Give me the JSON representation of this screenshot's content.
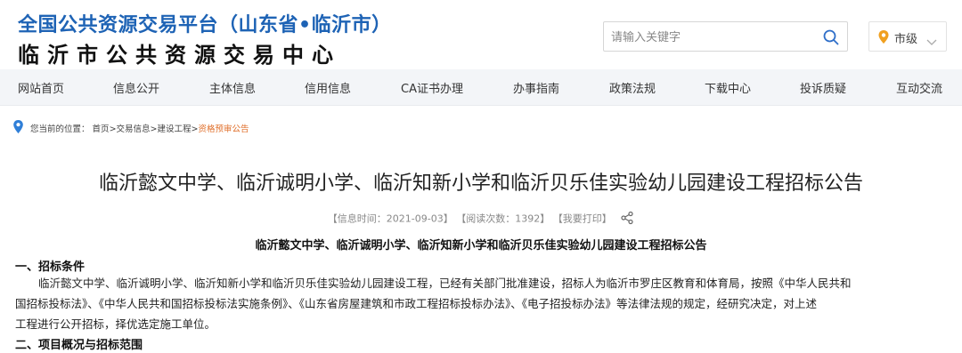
{
  "header": {
    "title_top": "全国公共资源交易平台（山东省•临沂市）",
    "title_bottom": "临沂市公共资源交易中心",
    "search_placeholder": "请输入关键字",
    "city_label": "市级"
  },
  "nav": {
    "items": [
      {
        "label": "网站首页"
      },
      {
        "label": "信息公开"
      },
      {
        "label": "主体信息"
      },
      {
        "label": "信用信息"
      },
      {
        "label": "CA证书办理"
      },
      {
        "label": "办事指南"
      },
      {
        "label": "政策法规"
      },
      {
        "label": "下载中心"
      },
      {
        "label": "投诉质疑"
      },
      {
        "label": "互动交流"
      }
    ]
  },
  "breadcrumb": {
    "prefix": "您当前的位置：",
    "items": [
      "首页",
      "交易信息",
      "建设工程",
      "资格预审公告"
    ],
    "separator": ">"
  },
  "article": {
    "title": "临沂懿文中学、临沂诚明小学、临沂知新小学和临沂贝乐佳实验幼儿园建设工程招标公告",
    "meta_time": "【信息时间：2021-09-03】",
    "meta_views": "【阅读次数：1392】",
    "meta_print": "【我要打印】",
    "content_title": "临沂懿文中学、临沂诚明小学、临沂知新小学和临沂贝乐佳实验幼儿园建设工程招标公告",
    "section1_title": "一、招标条件",
    "section1_lines": [
      "临沂懿文中学、临沂诚明小学、临沂知新小学和临沂贝乐佳实验幼儿园建设工程，已经有关部门批准建设，招标人为临沂市罗庄区教育和体育局，按照《中华人民共和",
      "国招标投标法》、《中华人民共和国招标投标法实施条例》、《山东省房屋建筑和市政工程招标投标办法》、《电子招投标办法》等法律法规的规定，经研究决定，对上述",
      "工程进行公开招标，择优选定施工单位。"
    ],
    "section2_title": "二、项目概况与招标范围"
  },
  "colors": {
    "brand_blue": "#1e63b5",
    "nav_bg": "#f3f5f8",
    "city_pin": "#f0a020",
    "breadcrumb_current": "#e0702c",
    "pin_blue": "#2f7fd8"
  },
  "icons": {
    "search": "search-icon",
    "city_pin": "location-pin-icon",
    "dropdown": "chevron-down-icon",
    "breadcrumb_pin": "location-pin-icon",
    "share": "share-icon"
  }
}
